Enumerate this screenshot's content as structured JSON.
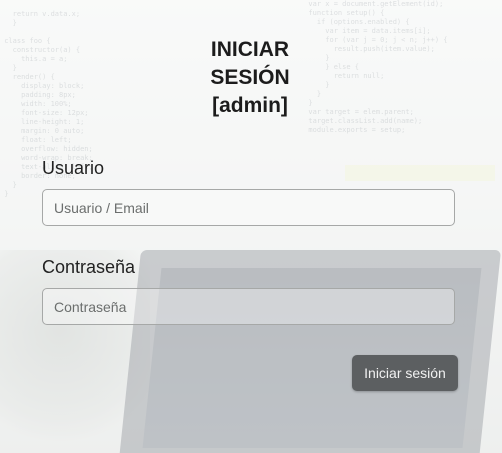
{
  "login": {
    "title_lines": [
      "INICIAR",
      "SESIÓN",
      "[admin]"
    ],
    "username": {
      "label": "Usuario",
      "value": "",
      "placeholder": "Usuario / Email"
    },
    "password": {
      "label": "Contraseña",
      "value": "",
      "placeholder": "Contraseña"
    },
    "submit_label": "Iniciar sesión"
  },
  "colors": {
    "button_bg": "#5c5f61",
    "button_text": "#f1f1f1",
    "title_text": "#1c1c1c",
    "field_border": "#a6a8a7"
  }
}
